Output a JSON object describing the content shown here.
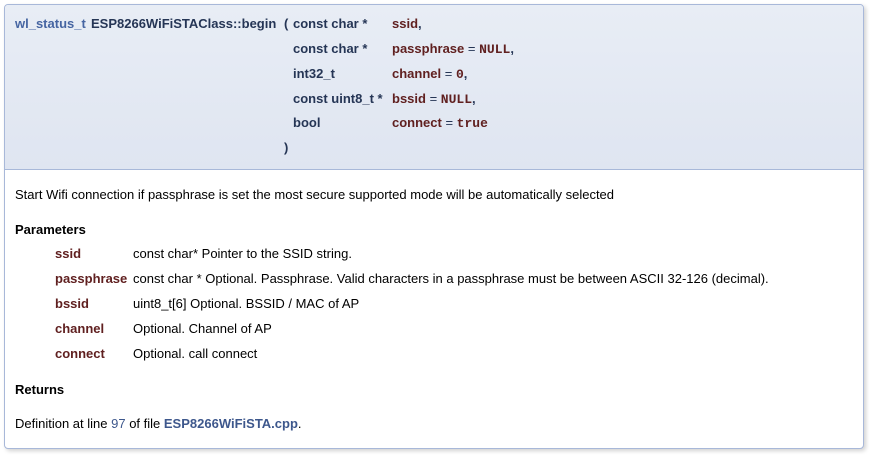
{
  "prototype": {
    "return_type": "wl_status_t",
    "function_name": "ESP8266WiFiSTAClass::begin",
    "open_paren": "(",
    "close_paren": ")",
    "params": [
      {
        "type": "const char *",
        "name": "ssid",
        "suffix": ",",
        "default": ""
      },
      {
        "type": "const char *",
        "name": "passphrase",
        "eq": " = ",
        "default": "NULL",
        "suffix": ","
      },
      {
        "type": "int32_t",
        "name": "channel",
        "eq": " = ",
        "default": "0",
        "suffix": ","
      },
      {
        "type": "const uint8_t *",
        "name": "bssid",
        "eq": " = ",
        "default": "NULL",
        "suffix": ","
      },
      {
        "type": "bool",
        "name": "connect",
        "eq": " = ",
        "default": "true",
        "suffix": ""
      }
    ]
  },
  "description": "Start Wifi connection if passphrase is set the most secure supported mode will be automatically selected",
  "parameters_heading": "Parameters",
  "parameters": [
    {
      "name": "ssid",
      "desc": "const char* Pointer to the SSID string."
    },
    {
      "name": "passphrase",
      "desc": "const char * Optional. Passphrase. Valid characters in a passphrase must be between ASCII 32-126 (decimal)."
    },
    {
      "name": "bssid",
      "desc": "uint8_t[6] Optional. BSSID / MAC of AP"
    },
    {
      "name": "channel",
      "desc": "Optional. Channel of AP"
    },
    {
      "name": "connect",
      "desc": "Optional. call connect"
    }
  ],
  "returns_heading": "Returns",
  "definition": {
    "prefix": "Definition at line ",
    "line": "97",
    "middle": " of file ",
    "file": "ESP8266WiFiSTA.cpp",
    "suffix": "."
  }
}
